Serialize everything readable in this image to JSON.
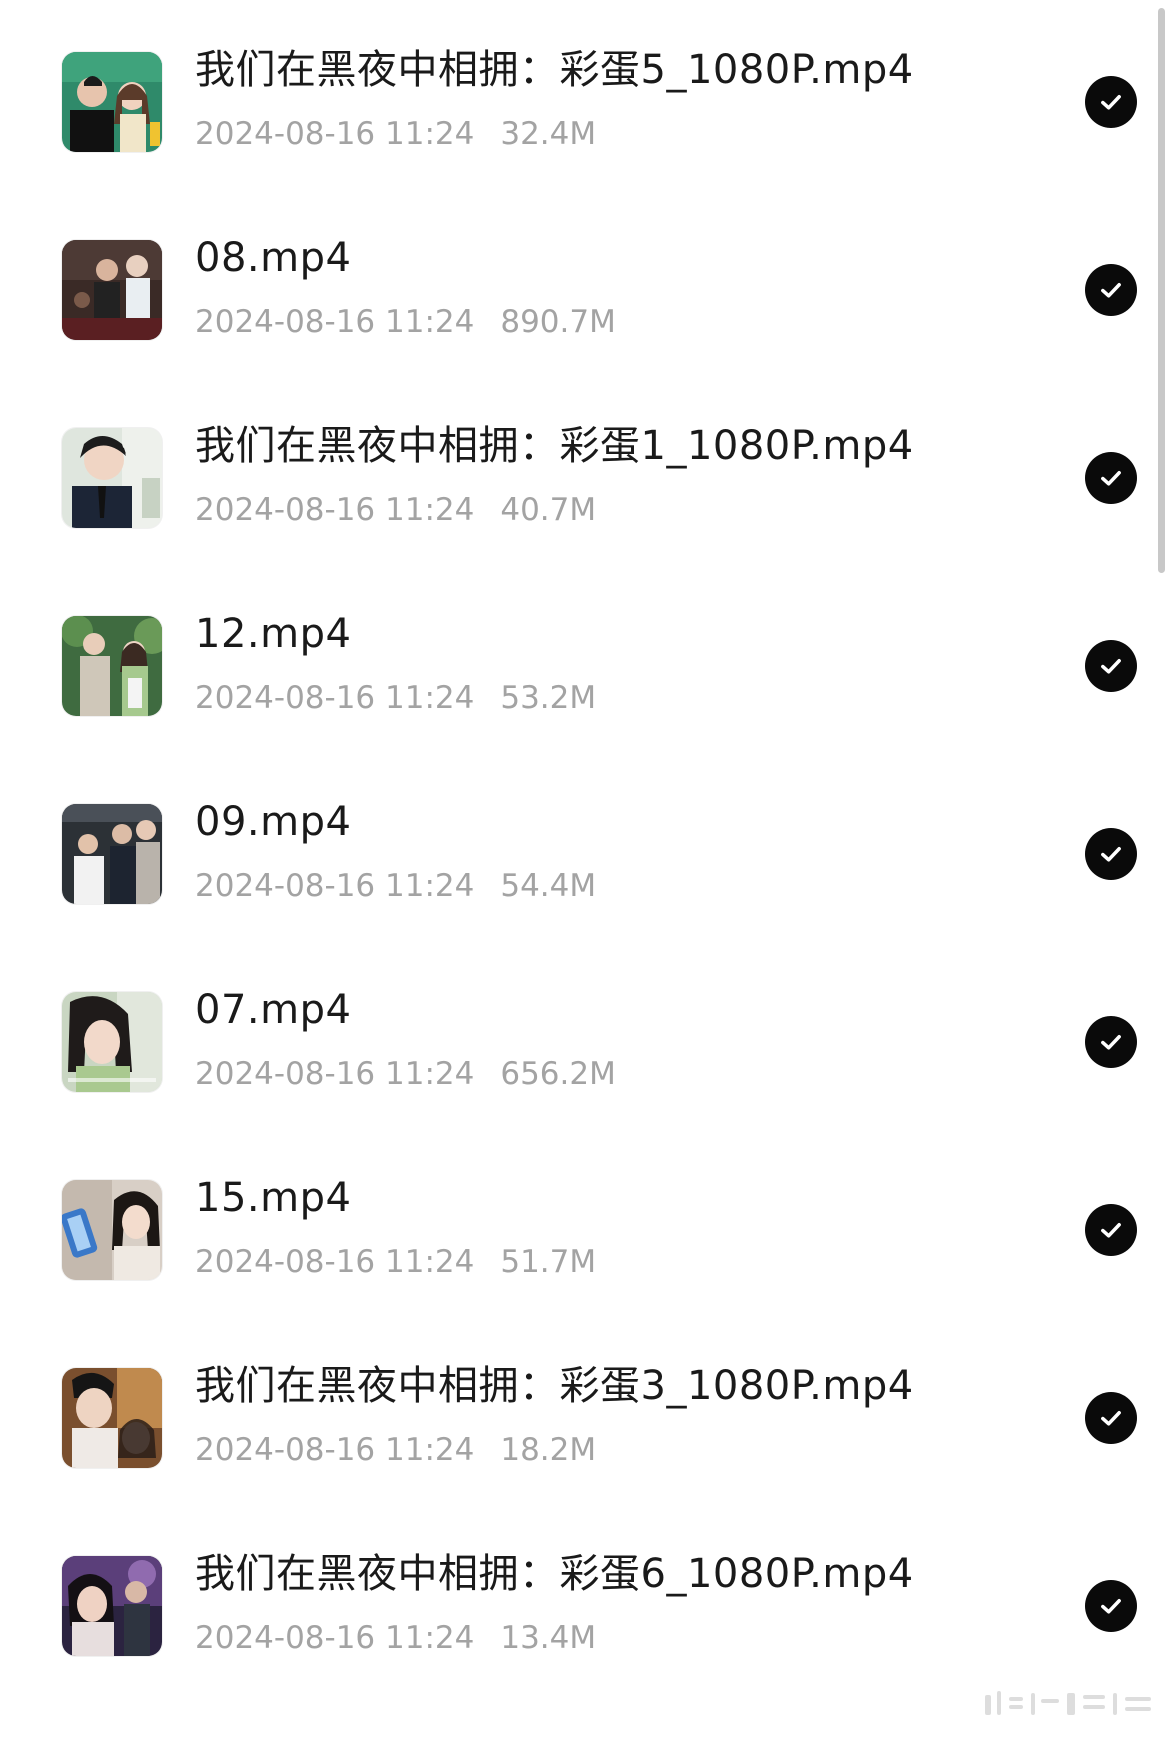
{
  "accent_color": "#0a0a0a",
  "meta_color": "#a3a3a3",
  "files": [
    {
      "name": "我们在黑夜中相拥：彩蛋5_1080P.mp4",
      "date": "2024-08-16 11:24",
      "size": "32.4M",
      "selected": true,
      "thumb_icon": "video-thumbnail"
    },
    {
      "name": "08.mp4",
      "date": "2024-08-16 11:24",
      "size": "890.7M",
      "selected": true,
      "thumb_icon": "video-thumbnail"
    },
    {
      "name": "我们在黑夜中相拥：彩蛋1_1080P.mp4",
      "date": "2024-08-16 11:24",
      "size": "40.7M",
      "selected": true,
      "thumb_icon": "video-thumbnail"
    },
    {
      "name": "12.mp4",
      "date": "2024-08-16 11:24",
      "size": "53.2M",
      "selected": true,
      "thumb_icon": "video-thumbnail"
    },
    {
      "name": "09.mp4",
      "date": "2024-08-16 11:24",
      "size": "54.4M",
      "selected": true,
      "thumb_icon": "video-thumbnail"
    },
    {
      "name": "07.mp4",
      "date": "2024-08-16 11:24",
      "size": "656.2M",
      "selected": true,
      "thumb_icon": "video-thumbnail"
    },
    {
      "name": "15.mp4",
      "date": "2024-08-16 11:24",
      "size": "51.7M",
      "selected": true,
      "thumb_icon": "video-thumbnail"
    },
    {
      "name": "我们在黑夜中相拥：彩蛋3_1080P.mp4",
      "date": "2024-08-16 11:24",
      "size": "18.2M",
      "selected": true,
      "thumb_icon": "video-thumbnail"
    },
    {
      "name": "我们在黑夜中相拥：彩蛋6_1080P.mp4",
      "date": "2024-08-16 11:24",
      "size": "13.4M",
      "selected": true,
      "thumb_icon": "video-thumbnail"
    }
  ]
}
